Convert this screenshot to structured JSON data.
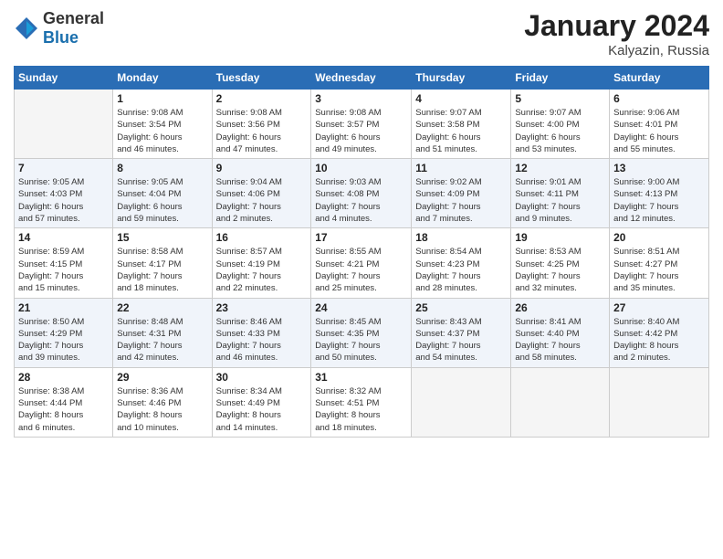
{
  "logo": {
    "general": "General",
    "blue": "Blue"
  },
  "title": {
    "month": "January 2024",
    "location": "Kalyazin, Russia"
  },
  "headers": [
    "Sunday",
    "Monday",
    "Tuesday",
    "Wednesday",
    "Thursday",
    "Friday",
    "Saturday"
  ],
  "weeks": [
    [
      {
        "day": "",
        "info": ""
      },
      {
        "day": "1",
        "info": "Sunrise: 9:08 AM\nSunset: 3:54 PM\nDaylight: 6 hours\nand 46 minutes."
      },
      {
        "day": "2",
        "info": "Sunrise: 9:08 AM\nSunset: 3:56 PM\nDaylight: 6 hours\nand 47 minutes."
      },
      {
        "day": "3",
        "info": "Sunrise: 9:08 AM\nSunset: 3:57 PM\nDaylight: 6 hours\nand 49 minutes."
      },
      {
        "day": "4",
        "info": "Sunrise: 9:07 AM\nSunset: 3:58 PM\nDaylight: 6 hours\nand 51 minutes."
      },
      {
        "day": "5",
        "info": "Sunrise: 9:07 AM\nSunset: 4:00 PM\nDaylight: 6 hours\nand 53 minutes."
      },
      {
        "day": "6",
        "info": "Sunrise: 9:06 AM\nSunset: 4:01 PM\nDaylight: 6 hours\nand 55 minutes."
      }
    ],
    [
      {
        "day": "7",
        "info": "Sunrise: 9:05 AM\nSunset: 4:03 PM\nDaylight: 6 hours\nand 57 minutes."
      },
      {
        "day": "8",
        "info": "Sunrise: 9:05 AM\nSunset: 4:04 PM\nDaylight: 6 hours\nand 59 minutes."
      },
      {
        "day": "9",
        "info": "Sunrise: 9:04 AM\nSunset: 4:06 PM\nDaylight: 7 hours\nand 2 minutes."
      },
      {
        "day": "10",
        "info": "Sunrise: 9:03 AM\nSunset: 4:08 PM\nDaylight: 7 hours\nand 4 minutes."
      },
      {
        "day": "11",
        "info": "Sunrise: 9:02 AM\nSunset: 4:09 PM\nDaylight: 7 hours\nand 7 minutes."
      },
      {
        "day": "12",
        "info": "Sunrise: 9:01 AM\nSunset: 4:11 PM\nDaylight: 7 hours\nand 9 minutes."
      },
      {
        "day": "13",
        "info": "Sunrise: 9:00 AM\nSunset: 4:13 PM\nDaylight: 7 hours\nand 12 minutes."
      }
    ],
    [
      {
        "day": "14",
        "info": "Sunrise: 8:59 AM\nSunset: 4:15 PM\nDaylight: 7 hours\nand 15 minutes."
      },
      {
        "day": "15",
        "info": "Sunrise: 8:58 AM\nSunset: 4:17 PM\nDaylight: 7 hours\nand 18 minutes."
      },
      {
        "day": "16",
        "info": "Sunrise: 8:57 AM\nSunset: 4:19 PM\nDaylight: 7 hours\nand 22 minutes."
      },
      {
        "day": "17",
        "info": "Sunrise: 8:55 AM\nSunset: 4:21 PM\nDaylight: 7 hours\nand 25 minutes."
      },
      {
        "day": "18",
        "info": "Sunrise: 8:54 AM\nSunset: 4:23 PM\nDaylight: 7 hours\nand 28 minutes."
      },
      {
        "day": "19",
        "info": "Sunrise: 8:53 AM\nSunset: 4:25 PM\nDaylight: 7 hours\nand 32 minutes."
      },
      {
        "day": "20",
        "info": "Sunrise: 8:51 AM\nSunset: 4:27 PM\nDaylight: 7 hours\nand 35 minutes."
      }
    ],
    [
      {
        "day": "21",
        "info": "Sunrise: 8:50 AM\nSunset: 4:29 PM\nDaylight: 7 hours\nand 39 minutes."
      },
      {
        "day": "22",
        "info": "Sunrise: 8:48 AM\nSunset: 4:31 PM\nDaylight: 7 hours\nand 42 minutes."
      },
      {
        "day": "23",
        "info": "Sunrise: 8:46 AM\nSunset: 4:33 PM\nDaylight: 7 hours\nand 46 minutes."
      },
      {
        "day": "24",
        "info": "Sunrise: 8:45 AM\nSunset: 4:35 PM\nDaylight: 7 hours\nand 50 minutes."
      },
      {
        "day": "25",
        "info": "Sunrise: 8:43 AM\nSunset: 4:37 PM\nDaylight: 7 hours\nand 54 minutes."
      },
      {
        "day": "26",
        "info": "Sunrise: 8:41 AM\nSunset: 4:40 PM\nDaylight: 7 hours\nand 58 minutes."
      },
      {
        "day": "27",
        "info": "Sunrise: 8:40 AM\nSunset: 4:42 PM\nDaylight: 8 hours\nand 2 minutes."
      }
    ],
    [
      {
        "day": "28",
        "info": "Sunrise: 8:38 AM\nSunset: 4:44 PM\nDaylight: 8 hours\nand 6 minutes."
      },
      {
        "day": "29",
        "info": "Sunrise: 8:36 AM\nSunset: 4:46 PM\nDaylight: 8 hours\nand 10 minutes."
      },
      {
        "day": "30",
        "info": "Sunrise: 8:34 AM\nSunset: 4:49 PM\nDaylight: 8 hours\nand 14 minutes."
      },
      {
        "day": "31",
        "info": "Sunrise: 8:32 AM\nSunset: 4:51 PM\nDaylight: 8 hours\nand 18 minutes."
      },
      {
        "day": "",
        "info": ""
      },
      {
        "day": "",
        "info": ""
      },
      {
        "day": "",
        "info": ""
      }
    ]
  ]
}
